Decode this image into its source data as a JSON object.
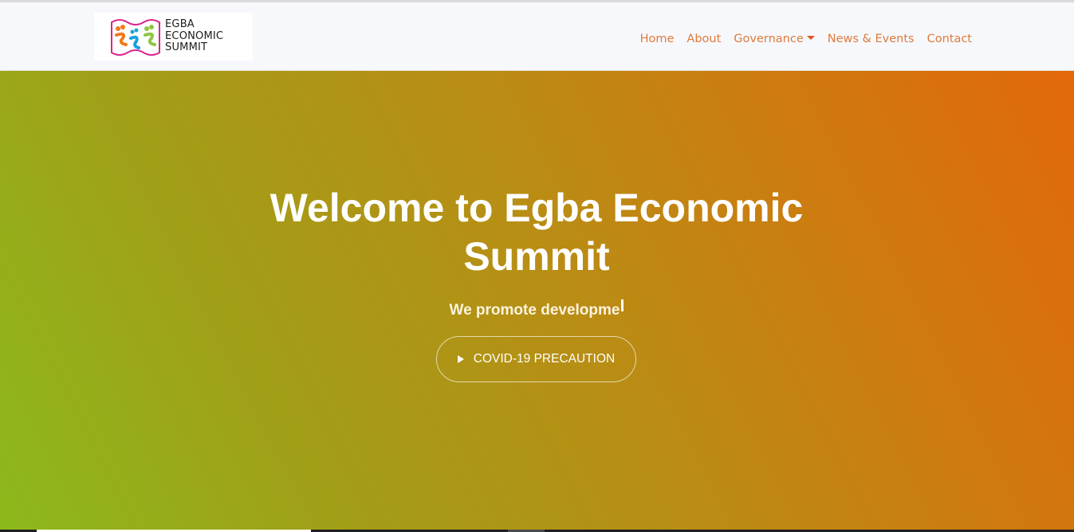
{
  "brand": {
    "logo_lines": [
      "EGBA",
      "ECONOMIC",
      "SUMMIT"
    ],
    "colors": [
      "#d9268c",
      "#f07a1a",
      "#1aa0e0",
      "#8cc63f"
    ]
  },
  "nav": {
    "items": [
      {
        "label": "Home"
      },
      {
        "label": "About"
      },
      {
        "label": "Governance",
        "dropdown": true
      },
      {
        "label": "News & Events"
      },
      {
        "label": "Contact"
      }
    ],
    "link_color": "#e07a3c"
  },
  "hero": {
    "title": "Welcome to Egba Economic Summit",
    "subtitle": "We promote developme",
    "cta_label": "COVID-19 PRECAUTION",
    "gradient": [
      "#8cb91c",
      "#e2680b"
    ]
  }
}
